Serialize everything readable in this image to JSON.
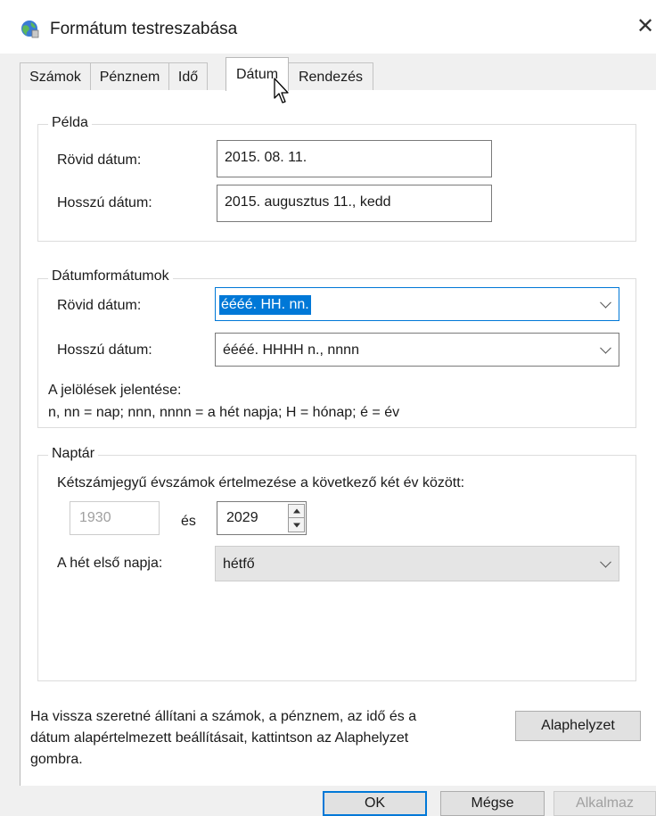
{
  "window": {
    "title": "Formátum testreszabása",
    "close_glyph": "✕"
  },
  "tabs": [
    {
      "label": "Számok"
    },
    {
      "label": "Pénznem"
    },
    {
      "label": "Idő"
    },
    {
      "label": "Dátum",
      "active": true
    },
    {
      "label": "Rendezés"
    }
  ],
  "example": {
    "legend": "Példa",
    "short_label": "Rövid dátum:",
    "short_value": "2015. 08. 11.",
    "long_label": "Hosszú dátum:",
    "long_value": "2015. augusztus 11., kedd"
  },
  "formats": {
    "legend": "Dátumformátumok",
    "short_label": "Rövid dátum:",
    "short_value": "éééé. HH. nn.",
    "long_label": "Hosszú dátum:",
    "long_value": "éééé. HHHH n., nnnn",
    "notation_title": "A jelölések jelentése:",
    "notation_text": "n, nn = nap; nnn, nnnn = a hét napja; H = hónap; é = év"
  },
  "calendar": {
    "legend": "Naptár",
    "range_text": "Kétszámjegyű évszámok értelmezése a következő két év között:",
    "from_year": "1930",
    "and_label": "és",
    "to_year": "2029",
    "first_day_label": "A hét első napja:",
    "first_day_value": "hétfő"
  },
  "reset": {
    "text_line1": "Ha vissza szeretné állítani a számok, a pénznem, az idő és a",
    "text_line2": "dátum alapértelmezett beállításait, kattintson az Alaphelyzet",
    "text_line3": "gombra.",
    "button_label": "Alaphelyzet"
  },
  "footer": {
    "ok_label": "OK",
    "cancel_label": "Mégse",
    "apply_label": "Alkalmaz"
  },
  "colors": {
    "accent": "#0078d7",
    "dialog_bg": "#f0f0f0"
  }
}
